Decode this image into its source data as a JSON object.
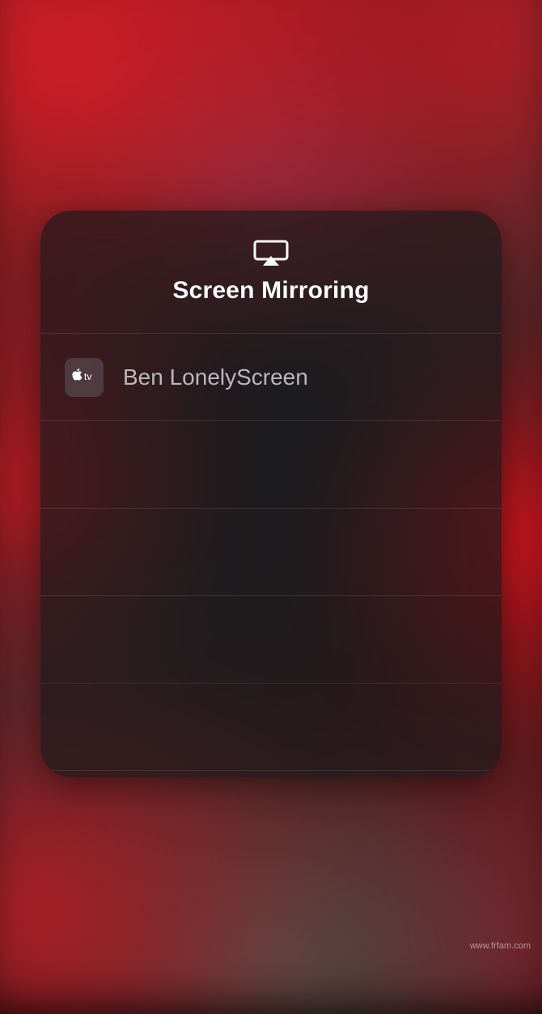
{
  "panel": {
    "title": "Screen Mirroring",
    "icon": "airplay-icon"
  },
  "devices": [
    {
      "name": "Ben LonelyScreen",
      "icon": "apple-tv-icon",
      "icon_label": "tv"
    }
  ],
  "watermark": "www.frfam.com"
}
